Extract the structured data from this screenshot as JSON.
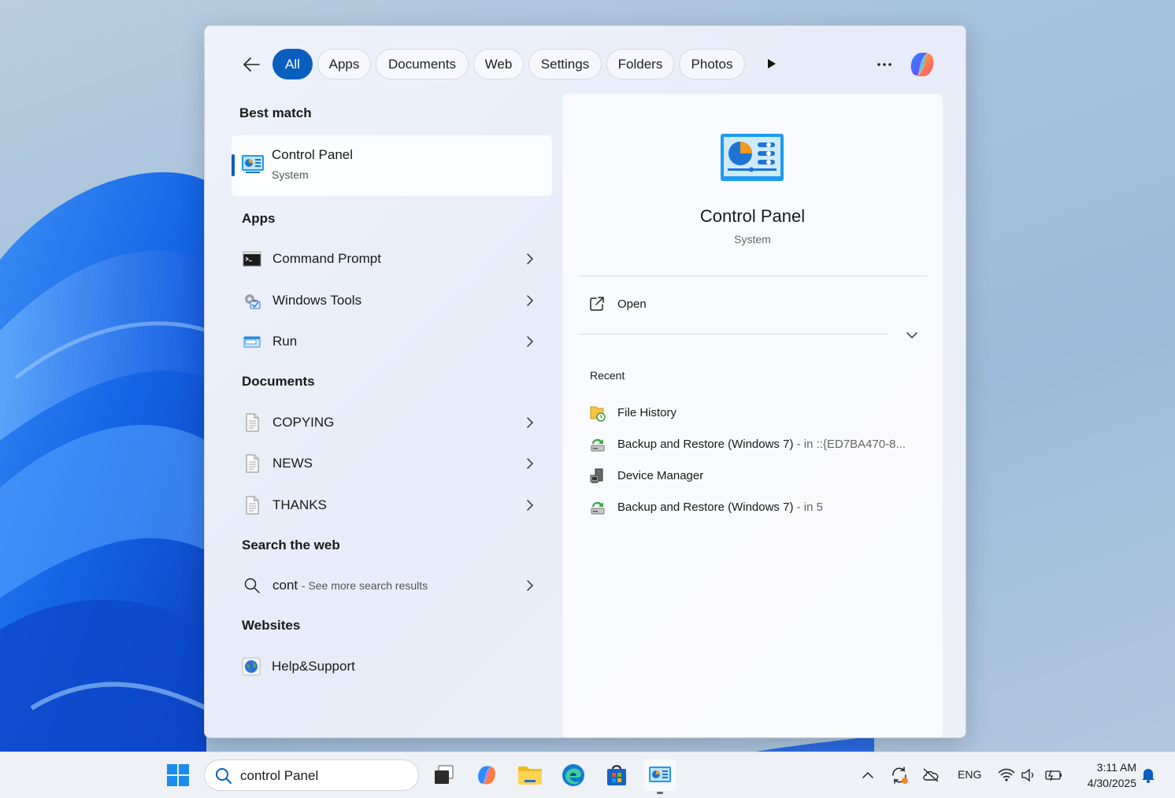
{
  "filters": {
    "chips": [
      "All",
      "Apps",
      "Documents",
      "Web",
      "Settings",
      "Folders",
      "Photos"
    ],
    "active": "All"
  },
  "best_match": {
    "heading": "Best match",
    "title": "Control Panel",
    "subtitle": "System"
  },
  "apps": {
    "heading": "Apps",
    "items": [
      {
        "label": "Command Prompt",
        "icon": "command-prompt-icon"
      },
      {
        "label": "Windows Tools",
        "icon": "windows-tools-icon"
      },
      {
        "label": "Run",
        "icon": "run-icon"
      }
    ]
  },
  "documents": {
    "heading": "Documents",
    "items": [
      {
        "label": "COPYING",
        "icon": "document-icon"
      },
      {
        "label": "NEWS",
        "icon": "document-icon"
      },
      {
        "label": "THANKS",
        "icon": "document-icon"
      }
    ]
  },
  "web": {
    "heading": "Search the web",
    "query": "cont",
    "suffix": "- See more search results"
  },
  "websites": {
    "heading": "Websites",
    "items": [
      {
        "label": "Help&Support",
        "icon": "globe-icon"
      }
    ]
  },
  "preview": {
    "title": "Control Panel",
    "subtitle": "System",
    "open_label": "Open",
    "recent_heading": "Recent",
    "recent": [
      {
        "label": "File History",
        "suffix": ""
      },
      {
        "label": "Backup and Restore (Windows 7)",
        "suffix": "- in ::{ED7BA470-8..."
      },
      {
        "label": "Device Manager",
        "suffix": ""
      },
      {
        "label": "Backup and Restore (Windows 7)",
        "suffix": "- in 5"
      }
    ]
  },
  "taskbar": {
    "search_text": "control Panel",
    "language": "ENG",
    "time": "3:11 AM",
    "date": "4/30/2025"
  },
  "colors": {
    "accent": "#0a5fbe",
    "wallpaper_blue": "#1f6fe0"
  }
}
